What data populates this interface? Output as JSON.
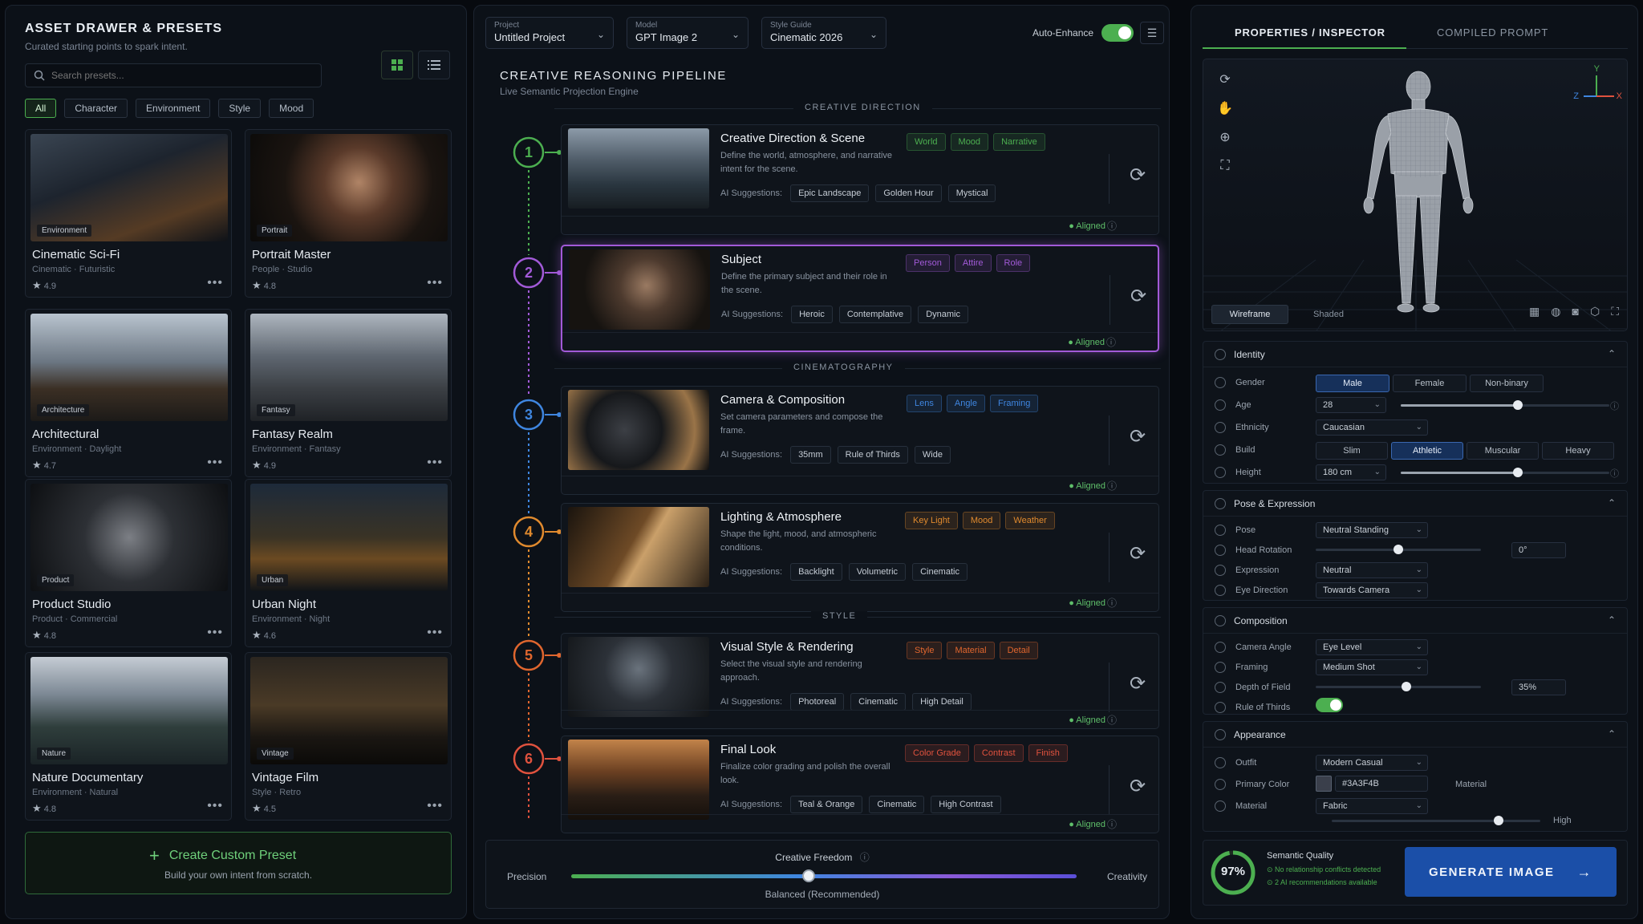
{
  "left": {
    "title": "ASSET DRAWER & PRESETS",
    "subtitle": "Curated starting points to spark intent.",
    "search_placeholder": "Search presets...",
    "filters": [
      "All",
      "Character",
      "Environment",
      "Style",
      "Mood"
    ],
    "active_filter": "All",
    "presets": [
      {
        "title": "Cinematic Sci-Fi",
        "tag": "Environment",
        "meta1": "Cinematic",
        "meta2": "Futuristic",
        "rating": "4.9"
      },
      {
        "title": "Portrait Master",
        "tag": "Portrait",
        "meta1": "People",
        "meta2": "Studio",
        "rating": "4.8"
      },
      {
        "title": "Architectural",
        "tag": "Architecture",
        "meta1": "Environment",
        "meta2": "Daylight",
        "rating": "4.7"
      },
      {
        "title": "Fantasy Realm",
        "tag": "Fantasy",
        "meta1": "Environment",
        "meta2": "Fantasy",
        "rating": "4.9"
      },
      {
        "title": "Product Studio",
        "tag": "Product",
        "meta1": "Product",
        "meta2": "Commercial",
        "rating": "4.8"
      },
      {
        "title": "Urban Night",
        "tag": "Urban",
        "meta1": "Environment",
        "meta2": "Night",
        "rating": "4.6"
      },
      {
        "title": "Nature Documentary",
        "tag": "Nature",
        "meta1": "Environment",
        "meta2": "Natural",
        "rating": "4.8"
      },
      {
        "title": "Vintage Film",
        "tag": "Vintage",
        "meta1": "Style",
        "meta2": "Retro",
        "rating": "4.5"
      }
    ],
    "create_title": "Create Custom Preset",
    "create_sub": "Build your own intent from scratch."
  },
  "topbar": {
    "project_label": "Project",
    "project_value": "Untitled Project",
    "model_label": "Model",
    "model_value": "GPT Image 2",
    "style_label": "Style Guide",
    "style_value": "Cinematic 2026",
    "auto_enhance": "Auto-Enhance"
  },
  "pipeline": {
    "title": "CREATIVE REASONING PIPELINE",
    "subtitle": "Live Semantic Projection Engine",
    "sections": [
      "CREATIVE DIRECTION",
      "CINEMATOGRAPHY",
      "STYLE"
    ],
    "suggestions_label": "AI Suggestions:",
    "aligned": "Aligned",
    "steps": [
      {
        "num": "1",
        "title": "Creative Direction & Scene",
        "desc": "Define the world, atmosphere, and narrative intent for the scene.",
        "chips": [
          "World",
          "Mood",
          "Narrative"
        ],
        "suggestions": [
          "Epic Landscape",
          "Golden Hour",
          "Mystical"
        ],
        "color": "#4caf50"
      },
      {
        "num": "2",
        "title": "Subject",
        "desc": "Define the primary subject and their role in the scene.",
        "chips": [
          "Person",
          "Attire",
          "Role"
        ],
        "suggestions": [
          "Heroic",
          "Contemplative",
          "Dynamic"
        ],
        "color": "#a25ad8"
      },
      {
        "num": "3",
        "title": "Camera & Composition",
        "desc": "Set camera parameters and compose the frame.",
        "chips": [
          "Lens",
          "Angle",
          "Framing"
        ],
        "suggestions": [
          "35mm",
          "Rule of Thirds",
          "Wide"
        ],
        "color": "#3f86e0"
      },
      {
        "num": "4",
        "title": "Lighting & Atmosphere",
        "desc": "Shape the light, mood, and atmospheric conditions.",
        "chips": [
          "Key Light",
          "Mood",
          "Weather"
        ],
        "suggestions": [
          "Backlight",
          "Volumetric",
          "Cinematic"
        ],
        "color": "#e08a2e"
      },
      {
        "num": "5",
        "title": "Visual Style & Rendering",
        "desc": "Select the visual style and rendering approach.",
        "chips": [
          "Style",
          "Material",
          "Detail"
        ],
        "suggestions": [
          "Photoreal",
          "Cinematic",
          "High Detail"
        ],
        "color": "#e0662e"
      },
      {
        "num": "6",
        "title": "Final Look",
        "desc": "Finalize color grading and polish the overall look.",
        "chips": [
          "Color Grade",
          "Contrast",
          "Finish"
        ],
        "suggestions": [
          "Teal & Orange",
          "Cinematic",
          "High Contrast"
        ],
        "color": "#e0523e"
      }
    ],
    "freedom_title": "Creative Freedom",
    "freedom_left": "Precision",
    "freedom_right": "Creativity",
    "freedom_value": "Balanced (Recommended)",
    "freedom_level": 0.47
  },
  "right": {
    "tab_active": "PROPERTIES / INSPECTOR",
    "tab_other": "COMPILED PROMPT",
    "view_wire": "Wireframe",
    "view_shaded": "Shaded",
    "axis_x": "X",
    "axis_y": "Y",
    "axis_z": "Z",
    "identity": {
      "title": "Identity",
      "gender_label": "Gender",
      "gender_opts": [
        "Male",
        "Female",
        "Non-binary"
      ],
      "age_label": "Age",
      "age_value": "28",
      "age_level": 0.56,
      "ethnicity_label": "Ethnicity",
      "ethnicity_value": "Caucasian",
      "build_label": "Build",
      "build_opts": [
        "Slim",
        "Athletic",
        "Muscular",
        "Heavy"
      ],
      "height_label": "Height",
      "height_value": "180 cm",
      "height_level": 0.56
    },
    "pose": {
      "title": "Pose & Expression",
      "pose_label": "Pose",
      "pose_value": "Neutral Standing",
      "head_label": "Head Rotation",
      "head_value": "0°",
      "head_level": 0.5,
      "expr_label": "Expression",
      "expr_value": "Neutral",
      "eye_label": "Eye Direction",
      "eye_value": "Towards Camera"
    },
    "composition": {
      "title": "Composition",
      "angle_label": "Camera Angle",
      "angle_value": "Eye Level",
      "framing_label": "Framing",
      "framing_value": "Medium Shot",
      "dof_label": "Depth of Field",
      "dof_value": "35%",
      "dof_level": 0.35,
      "rot_label": "Rule of Thirds"
    },
    "appearance": {
      "title": "Appearance",
      "outfit_label": "Outfit",
      "outfit_value": "Modern Casual",
      "color_label": "Primary Color",
      "color_value": "#3A3F4B",
      "color_suffix": "Material",
      "material_label": "Material",
      "material_value": "Fabric",
      "material_high": "High",
      "material_level": 0.8
    },
    "quality": {
      "score": "97%",
      "title": "Semantic Quality",
      "line1": "No relationship conflicts detected",
      "line2": "2 AI recommendations available",
      "level": 0.97
    },
    "generate": "GENERATE IMAGE"
  },
  "colors": {
    "accent_green": "#4caf50",
    "accent_blue": "#1b4fa8",
    "accent_purple": "#a25ad8"
  }
}
